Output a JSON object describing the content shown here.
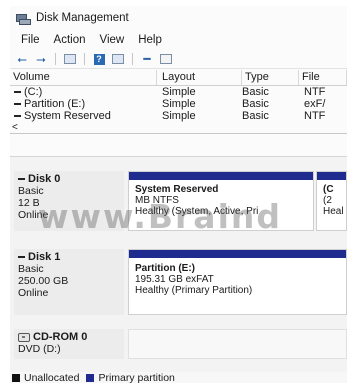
{
  "window": {
    "title": "Disk Management"
  },
  "menu": [
    "File",
    "Action",
    "View",
    "Help"
  ],
  "toolbar_icons": [
    "back-arrow-icon",
    "forward-arrow-icon",
    "console-tree-icon",
    "help-icon",
    "properties-icon",
    "connect-icon",
    "view-icon"
  ],
  "volume_table": {
    "columns": [
      "Volume",
      "Layout",
      "Type",
      "File"
    ],
    "rows": [
      [
        "(C:)",
        "Simple",
        "Basic",
        "NTF"
      ],
      [
        "Partition (E:)",
        "Simple",
        "Basic",
        "exF/"
      ],
      [
        "System Reserved",
        "Simple",
        "Basic",
        "NTF"
      ]
    ],
    "scroll_left": "<"
  },
  "disks": [
    {
      "name": "Disk 0",
      "type": "Basic",
      "size": "12",
      "size_suffix": "B",
      "status": "Online",
      "partitions": [
        {
          "name": "System Reserved",
          "size": "MB NTFS",
          "status": "Healthy (System, Active, Pri"
        },
        {
          "name": "(C",
          "size": "(2",
          "status": "Heal"
        }
      ]
    },
    {
      "name": "Disk 1",
      "type": "Basic",
      "size": "250.00 GB",
      "status": "Online",
      "partitions": [
        {
          "name": "Partition  (E:)",
          "size": "195.31 GB exFAT",
          "status": "Healthy (Primary Partition)"
        }
      ]
    },
    {
      "name": "CD-ROM 0",
      "type": "DVD (D:)"
    }
  ],
  "legend": [
    {
      "label": "Unallocated",
      "color": "#111111"
    },
    {
      "label": "Primary partition",
      "color": "#1f2b8f"
    }
  ],
  "watermark": "www.Braind"
}
